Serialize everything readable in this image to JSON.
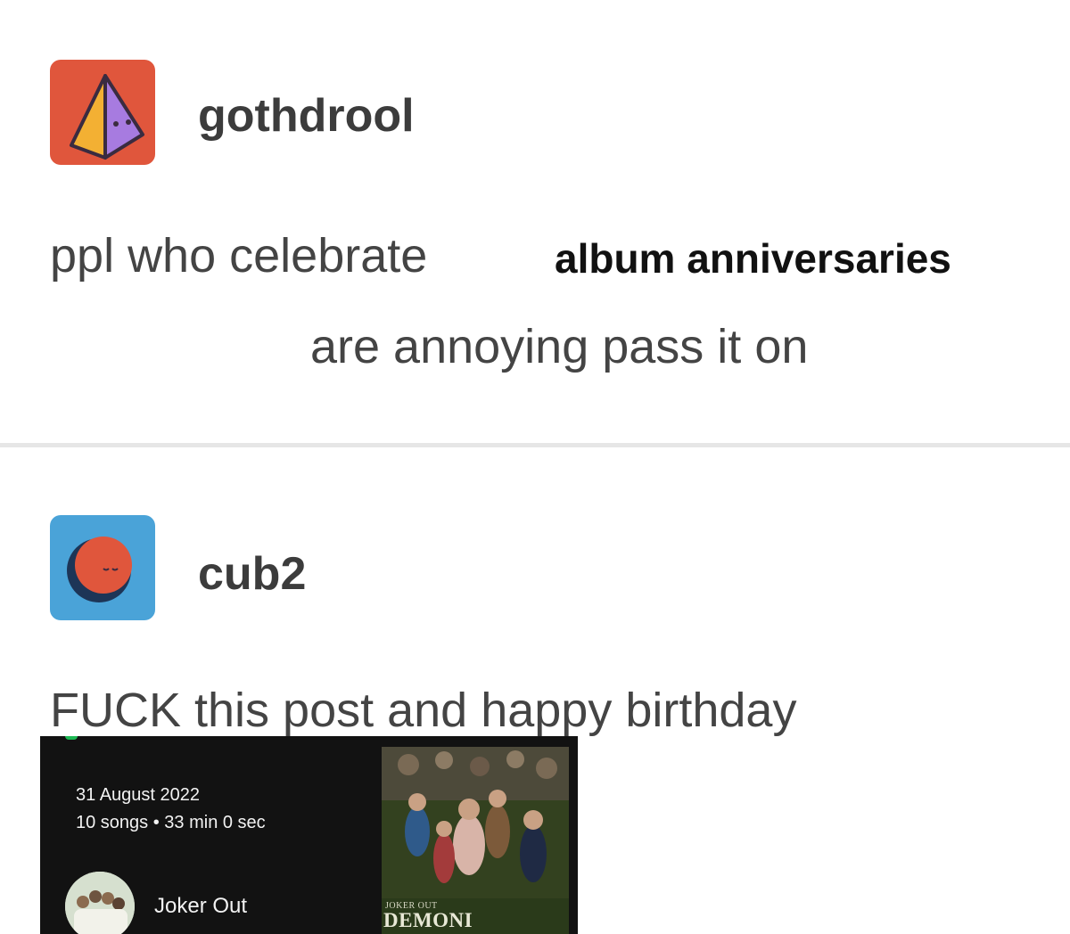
{
  "posts": [
    {
      "username": "gothdrool",
      "avatar_icon": "pyramid-face-icon",
      "text_line1": "ppl who celebrate",
      "text_highlight": "album anniversaries",
      "text_line2": "are annoying pass it on"
    },
    {
      "username": "cub2",
      "avatar_icon": "moon-face-icon",
      "text": "FUCK this post and happy birthday"
    }
  ],
  "album_card": {
    "release_date": "31 August 2022",
    "details": "10 songs • 33 min 0 sec",
    "artist": "Joker Out",
    "cover_band_label": "JOKER OUT",
    "cover_title": "DEMONI"
  },
  "colors": {
    "avatar1_bg": "#e0563c",
    "avatar2_bg": "#4aa3d8",
    "card_bg": "#121212",
    "accent_green": "#1db954"
  }
}
